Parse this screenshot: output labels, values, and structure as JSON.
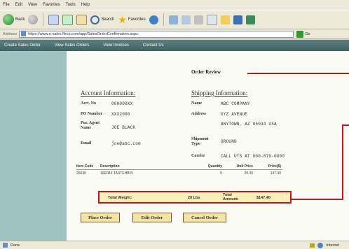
{
  "menu": [
    "File",
    "Edit",
    "View",
    "Favorites",
    "Tools",
    "Help"
  ],
  "toolbar": {
    "back": "Back",
    "search": "Search",
    "favorites": "Favorites"
  },
  "address": {
    "label": "Address",
    "url": "https://www.e-sales.ffxco.com/app/SalesOrderConfirmation.aspx",
    "go": "Go"
  },
  "nav": [
    "Create Sales Order",
    "View Sales Orders",
    "View Invoices",
    "Contact Us"
  ],
  "page": {
    "title": "Order Review",
    "account_heading": "Account Information:",
    "shipping_heading": "Shipping Information:"
  },
  "account": {
    "acct_no_label": "Acct. No",
    "acct_no": "000000XX",
    "po_label": "PO Number",
    "po": "XXX2000",
    "agent_label": "Pur. Agent Name",
    "agent": "JOE BLACK",
    "email_label": "Email",
    "email": "joe@abc.com"
  },
  "shipping": {
    "name_label": "Name",
    "name": "ABC COMPANY",
    "address_label": "Address",
    "address_line1": "XYZ AVENUE",
    "address_line2": "ANYTOWN, AZ 85034 USA",
    "shipment_type_label": "Shipment Type",
    "shipment_type": "GROUND",
    "carrier_label": "Carrier",
    "carrier": "CALL UTS AT 800-879-0000"
  },
  "items": {
    "headers": [
      "Item Code",
      "Description",
      "Quantity",
      "Unit Price",
      "Price($)"
    ],
    "rows": [
      [
        "26030",
        "16E084-TASTEHBPL",
        "5",
        "29.40",
        "147.40"
      ]
    ]
  },
  "totals": {
    "weight_label": "Total Weight:",
    "weight": "20 Lbs",
    "amount_label": "Total Amount:",
    "amount": "$147.40"
  },
  "buttons": {
    "place": "Place Order",
    "edit": "Edit Order",
    "cancel": "Cancel Order"
  },
  "status": {
    "left": "Done",
    "zone": "Internet"
  },
  "colors": {
    "callout": "#c8141b",
    "nav_bg": "#4e7272",
    "side_stripe": "#9fc4c0",
    "button_bg": "#f3e3a7"
  }
}
